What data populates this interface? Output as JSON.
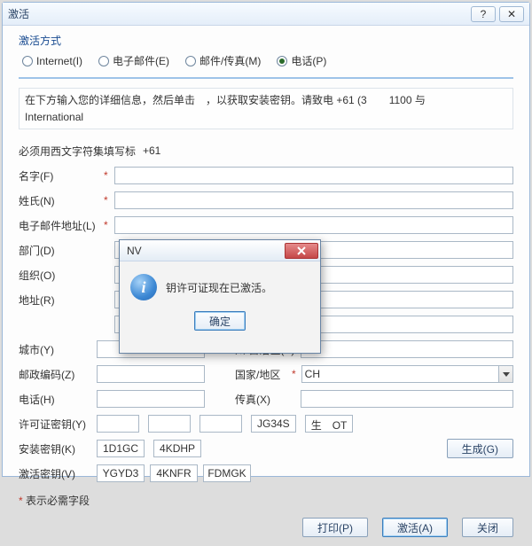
{
  "window": {
    "title": "激活",
    "help_glyph": "?",
    "close_glyph": "✕"
  },
  "group_label": "激活方式",
  "radios": {
    "internet": "Internet(I)",
    "email": "电子邮件(E)",
    "fax": "邮件/传真(M)",
    "phone": "电话(P)"
  },
  "desc_line1": "在下方输入您的详细信息，然后单击 ，以获取安装密钥。请致电 +61 (3   1100 与",
  "desc_line2": "International",
  "hint_label": "必须用西文字符集填写标",
  "hint_val": "+61",
  "fields": {
    "first": "名字(F)",
    "last": "姓氏(N)",
    "email": "电子邮件地址(L)",
    "dept": "部门(D)",
    "org": "组织(O)",
    "addr": "地址(R)",
    "city": "城市(Y)",
    "state": "州/自治区(Y)",
    "zip": "邮政编码(Z)",
    "country": "国家/地区",
    "phone": "电话(H)",
    "fax": "传真(X)",
    "lic": "许可证密钥(Y)",
    "inst": "安装密钥(K)",
    "act": "激活密钥(V)"
  },
  "country_value": "CH",
  "lic_parts": [
    "",
    "",
    "",
    "JG34S",
    "生​ OT"
  ],
  "inst_parts": [
    "1D1GC",
    "4KDHP"
  ],
  "act_parts": [
    "YGYD3",
    "4KNFR",
    "FDMGK"
  ],
  "gen_btn": "生成(G)",
  "req_note": "表示必需字段",
  "btns": {
    "print": "打印(P)",
    "activate": "激活(A)",
    "close": "关闭"
  },
  "dialog": {
    "title": "NV",
    "msg": "钥许可证现在已激活。",
    "ok": "确定"
  }
}
